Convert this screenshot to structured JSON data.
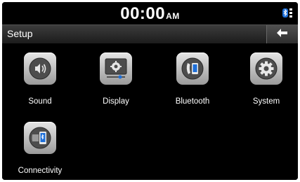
{
  "status": {
    "time": "00:00",
    "ampm": "AM",
    "bluetooth_icon": "bluetooth-icon"
  },
  "header": {
    "title": "Setup",
    "back_icon": "back-arrow-icon"
  },
  "menu": {
    "items": [
      {
        "label": "Sound",
        "icon": "speaker-icon"
      },
      {
        "label": "Display",
        "icon": "display-settings-icon"
      },
      {
        "label": "Bluetooth",
        "icon": "phone-icon"
      },
      {
        "label": "System",
        "icon": "gear-icon"
      },
      {
        "label": "Connectivity",
        "icon": "phone-connect-icon"
      }
    ]
  },
  "colors": {
    "background": "#000000",
    "icon_tile": "#c8c8c8",
    "icon_disc": "#555555"
  }
}
